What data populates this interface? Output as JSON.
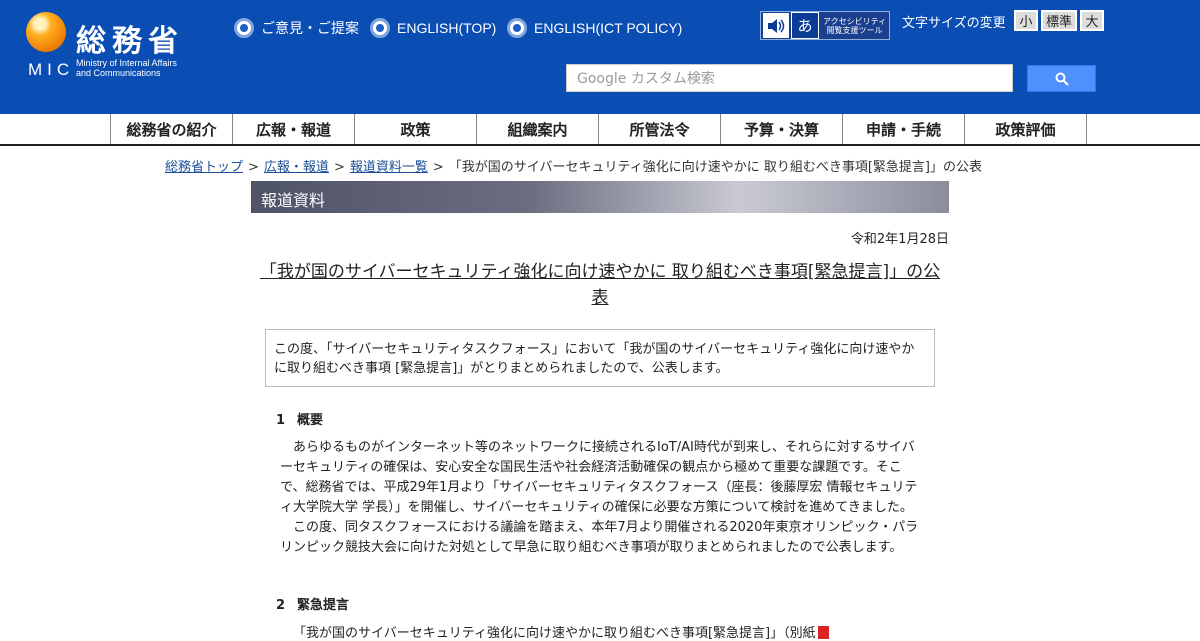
{
  "header": {
    "logo": {
      "kanji": "総務省",
      "abbr": "MIC",
      "english_line1": "Ministry of Internal Affairs",
      "english_line2": "and Communications"
    },
    "top_links": [
      {
        "label": "ご意見・ご提案"
      },
      {
        "label": "ENGLISH(TOP)"
      },
      {
        "label": "ENGLISH(ICT POLICY)"
      }
    ],
    "accessibility_tool": {
      "line1": "アクセシビリティ",
      "line2": "閲覧支援ツール",
      "icon_char": "あ"
    },
    "font_size": {
      "label": "文字サイズの変更",
      "small": "小",
      "standard": "標準",
      "large": "大"
    },
    "search": {
      "placeholder": "Google カスタム検索"
    },
    "colors": {
      "header_bg": "#0a4db3",
      "search_button": "#4d90fe"
    }
  },
  "nav": {
    "items": [
      "総務省の紹介",
      "広報・報道",
      "政策",
      "組織案内",
      "所管法令",
      "予算・決算",
      "申請・手続",
      "政策評価"
    ]
  },
  "breadcrumb": {
    "items": [
      "総務省トップ",
      "広報・報道",
      "報道資料一覧"
    ],
    "separator": ">",
    "current": "「我が国のサイバーセキュリティ強化に向け速やかに 取り組むべき事項[緊急提言]」の公表"
  },
  "section": {
    "banner": "報道資料"
  },
  "article": {
    "date": "令和2年1月28日",
    "title": "「我が国のサイバーセキュリティ強化に向け速やかに 取り組むべき事項[緊急提言]」の公表",
    "summary": "この度、「サイバーセキュリティタスクフォース」において「我が国のサイバーセキュリティ強化に向け速やかに取り組むべき事項 [緊急提言]」がとりまとめられましたので、公表します。",
    "sections": [
      {
        "number": "1",
        "heading": "概要",
        "paragraphs": [
          "あらゆるものがインターネット等のネットワークに接続されるIoT/AI時代が到来し、それらに対するサイバーセキュリティの確保は、安心安全な国民生活や社会経済活動確保の観点から極めて重要な課題です。そこで、総務省では、平成29年1月より「サイバーセキュリティタスクフォース（座長：後藤厚宏 情報セキュリティ大学院大学 学長）」を開催し、サイバーセキュリティの確保に必要な方策について検討を進めてきました。",
          "この度、同タスクフォースにおける議論を踏まえ、本年7月より開催される2020年東京オリンピック・パラリンピック競技大会に向けた対処として早急に取り組むべき事項が取りまとめられましたので公表します。"
        ]
      },
      {
        "number": "2",
        "heading": "緊急提言",
        "partial_line": "「我が国のサイバーセキュリティ強化に向け速やかに取り組むべき事項[緊急提言]」（別紙"
      }
    ]
  }
}
